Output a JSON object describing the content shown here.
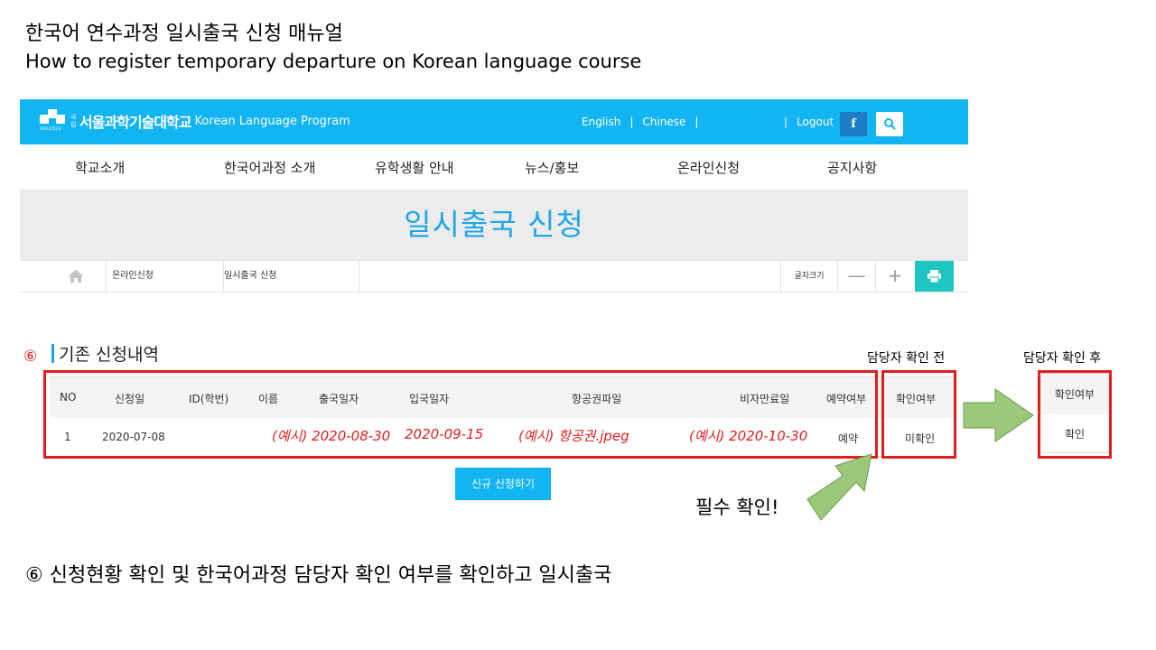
{
  "slide": {
    "title": "한국어 연수과정 일시출국 신청 매뉴얼",
    "subtitle": "How to register temporary departure on Korean language course"
  },
  "site": {
    "logo_small": "국립",
    "logo_name": "서울과학기술대학교",
    "logo_program": "Korean Language Program",
    "logo_caption": "SEOULTECH",
    "lang_english": "English",
    "lang_chinese": "Chinese",
    "sep": "|",
    "logout": "Logout",
    "facebook_glyph": "f",
    "nav": [
      "학교소개",
      "한국어과정 소개",
      "유학생활 안내",
      "뉴스/홍보",
      "온라인신청",
      "공지사항"
    ],
    "banner_title": "일시출국 신청",
    "breadcrumb": [
      "온라인신청",
      "일시출국 신청"
    ],
    "font_size_label": "글자크기",
    "minus": "—",
    "plus": "+"
  },
  "section": {
    "number": "⑥",
    "title": "기존 신청내역"
  },
  "labels": {
    "before": "담당자 확인 전",
    "after": "담당자 확인 후"
  },
  "table": {
    "headers": [
      "NO",
      "신청일",
      "ID(학번)",
      "이름",
      "출국일자",
      "입국일자",
      "항공권파일",
      "비자만료일",
      "예약여부",
      "확인여부"
    ],
    "row": {
      "no": "1",
      "apply_date": "2020-07-08",
      "departure": "(예시) 2020-08-30",
      "entry": "2020-09-15",
      "ticket": "(예시) 항공권.jpeg",
      "visa_expiry": "(예시) 2020-10-30",
      "reservation": "예약",
      "confirm": "미확인"
    }
  },
  "after": {
    "header": "확인여부",
    "value": "확인"
  },
  "new_button": "신규 신청하기",
  "must_check": "필수 확인!",
  "bottom_note": "⑥ 신청현황 확인 및 한국어과정 담당자 확인 여부를 확인하고 일시출국",
  "colors": {
    "accent": "#12b4f1",
    "annotation_red": "#e01e1e",
    "arrow_green": "#9bc97a",
    "print_teal": "#1ec5c0"
  }
}
